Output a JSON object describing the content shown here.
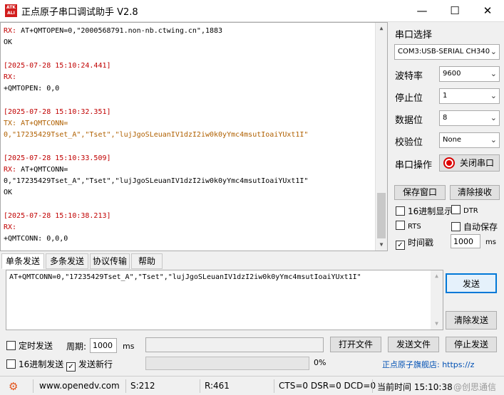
{
  "window": {
    "logo_text": "ATK ALIENTEK",
    "title": "正点原子串口调试助手 V2.8",
    "minimize_glyph": "—",
    "maximize_glyph": "☐",
    "close_glyph": "✕"
  },
  "terminal": {
    "lines": [
      {
        "text": "RX: AT+QMTOPEN=0,\"2000568791.non-nb.ctwing.cn\",1883",
        "kind": "rx-mixed"
      },
      {
        "text": "OK",
        "kind": "plain"
      },
      {
        "text": "",
        "kind": "blank"
      },
      {
        "text": "[2025-07-28 15:10:24.441]",
        "kind": "ts"
      },
      {
        "text": "RX:",
        "kind": "rx"
      },
      {
        "text": "+QMTOPEN: 0,0",
        "kind": "plain"
      },
      {
        "text": "",
        "kind": "blank"
      },
      {
        "text": "[2025-07-28 15:10:32.351]",
        "kind": "ts"
      },
      {
        "text": "TX: AT+QMTCONN=",
        "kind": "tx"
      },
      {
        "text": "0,\"17235429Tset_A\",\"Tset\",\"lujJgoSLeuanIV1dzI2iw0k0yYmc4msutIoaiYUxt1I\"",
        "kind": "tx"
      },
      {
        "text": "",
        "kind": "blank"
      },
      {
        "text": "[2025-07-28 15:10:33.509]",
        "kind": "ts"
      },
      {
        "text": "RX: AT+QMTCONN=",
        "kind": "rx-mixed"
      },
      {
        "text": "0,\"17235429Tset_A\",\"Tset\",\"lujJgoSLeuanIV1dzI2iw0k0yYmc4msutIoaiYUxt1I\"",
        "kind": "plain"
      },
      {
        "text": "OK",
        "kind": "plain"
      },
      {
        "text": "",
        "kind": "blank"
      },
      {
        "text": "[2025-07-28 15:10:38.213]",
        "kind": "ts"
      },
      {
        "text": "RX:",
        "kind": "rx"
      },
      {
        "text": "+QMTCONN: 0,0,0",
        "kind": "plain"
      }
    ]
  },
  "serial": {
    "section_label": "串口选择",
    "port_value": "COM3:USB-SERIAL CH340",
    "baud_label": "波特率",
    "baud_value": "9600",
    "stopbits_label": "停止位",
    "stopbits_value": "1",
    "databits_label": "数据位",
    "databits_value": "8",
    "parity_label": "校验位",
    "parity_value": "None",
    "operation_label": "串口操作",
    "close_port_label": "关闭串口"
  },
  "receive_options": {
    "save_window_label": "保存窗口",
    "clear_receive_label": "清除接收",
    "hex_display_label": "16进制显示",
    "hex_display_checked": false,
    "dtr_label": "DTR",
    "dtr_checked": false,
    "rts_label": "RTS",
    "rts_checked": false,
    "auto_save_label": "自动保存",
    "auto_save_checked": false,
    "timestamp_label": "时间戳",
    "timestamp_checked": true,
    "timestamp_value": "1000",
    "timestamp_unit": "ms"
  },
  "tabs": [
    "单条发送",
    "多条发送",
    "协议传输",
    "帮助"
  ],
  "send": {
    "text": "AT+QMTCONN=0,\"17235429Tset_A\",\"Tset\",\"lujJgoSLeuanIV1dzI2iw0k0yYmc4msutIoaiYUxt1I\"",
    "send_label": "发送",
    "clear_send_label": "清除发送",
    "timed_send_label": "定时发送",
    "timed_send_checked": false,
    "period_label": "周期:",
    "period_value": "1000",
    "period_unit": "ms",
    "open_file_label": "打开文件",
    "send_file_label": "发送文件",
    "stop_send_label": "停止发送",
    "hex_send_label": "16进制发送",
    "hex_send_checked": false,
    "newline_label": "发送新行",
    "newline_checked": true,
    "progress_percent": 0,
    "progress_text": "0%",
    "promo_text": "正点原子旗舰店: https://z"
  },
  "statusbar": {
    "url": "www.openedv.com",
    "sent": "S:212",
    "received": "R:461",
    "lines_status": "CTS=0 DSR=0 DCD=0",
    "time_text": "当前时间 15:10:38",
    "watermark": "@创思通信"
  },
  "colors": {
    "rx": "#c00000",
    "tx": "#b06000",
    "timestamp": "#c00000",
    "accent_blue": "#0078d7",
    "promo": "#0050b4",
    "status_gear": "#e2541b"
  }
}
